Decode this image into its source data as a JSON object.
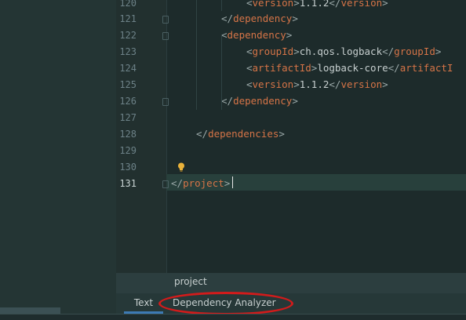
{
  "lines": [
    {
      "num": "120",
      "parts": [
        {
          "c": "punct",
          "t": "<"
        },
        {
          "c": "tag",
          "t": "version"
        },
        {
          "c": "punct",
          "t": ">"
        },
        {
          "c": "txt",
          "t": "1.1.2"
        },
        {
          "c": "punct",
          "t": "</"
        },
        {
          "c": "tag",
          "t": "version"
        },
        {
          "c": "punct",
          "t": ">"
        }
      ]
    },
    {
      "num": "121",
      "parts": [
        {
          "c": "punct",
          "t": "</"
        },
        {
          "c": "tag",
          "t": "dependency"
        },
        {
          "c": "punct",
          "t": ">"
        }
      ]
    },
    {
      "num": "122",
      "parts": [
        {
          "c": "punct",
          "t": "<"
        },
        {
          "c": "tag",
          "t": "dependency"
        },
        {
          "c": "punct",
          "t": ">"
        }
      ]
    },
    {
      "num": "123",
      "parts": [
        {
          "c": "punct",
          "t": "<"
        },
        {
          "c": "tag",
          "t": "groupId"
        },
        {
          "c": "punct",
          "t": ">"
        },
        {
          "c": "txt",
          "t": "ch.qos.logback"
        },
        {
          "c": "punct",
          "t": "</"
        },
        {
          "c": "tag",
          "t": "groupId"
        },
        {
          "c": "punct",
          "t": ">"
        }
      ]
    },
    {
      "num": "124",
      "parts": [
        {
          "c": "punct",
          "t": "<"
        },
        {
          "c": "tag",
          "t": "artifactId"
        },
        {
          "c": "punct",
          "t": ">"
        },
        {
          "c": "txt",
          "t": "logback-core"
        },
        {
          "c": "punct",
          "t": "</"
        },
        {
          "c": "tag",
          "t": "artifactI"
        }
      ]
    },
    {
      "num": "125",
      "parts": [
        {
          "c": "punct",
          "t": "<"
        },
        {
          "c": "tag",
          "t": "version"
        },
        {
          "c": "punct",
          "t": ">"
        },
        {
          "c": "txt",
          "t": "1.1.2"
        },
        {
          "c": "punct",
          "t": "</"
        },
        {
          "c": "tag",
          "t": "version"
        },
        {
          "c": "punct",
          "t": ">"
        }
      ]
    },
    {
      "num": "126",
      "parts": [
        {
          "c": "punct",
          "t": "</"
        },
        {
          "c": "tag",
          "t": "dependency"
        },
        {
          "c": "punct",
          "t": ">"
        }
      ]
    },
    {
      "num": "127",
      "parts": []
    },
    {
      "num": "128",
      "parts": [
        {
          "c": "punct",
          "t": "</"
        },
        {
          "c": "tag",
          "t": "dependencies"
        },
        {
          "c": "punct",
          "t": ">"
        }
      ]
    },
    {
      "num": "129",
      "parts": []
    },
    {
      "num": "130",
      "parts": []
    },
    {
      "num": "131",
      "parts": [
        {
          "c": "punct",
          "t": "</"
        },
        {
          "c": "tag",
          "t": "project"
        },
        {
          "c": "punct",
          "t": ">"
        }
      ]
    }
  ],
  "current_line": "131",
  "breadcrumb": "project",
  "tabs": {
    "text": "Text",
    "dependency_analyzer": "Dependency Analyzer"
  },
  "icons": {
    "intention": "lightbulb-icon",
    "fold": "fold-marker-icon"
  },
  "colors": {
    "tag": "#d57447",
    "highlight": "#d21b1b",
    "active_tab": "#3d7ab4"
  }
}
